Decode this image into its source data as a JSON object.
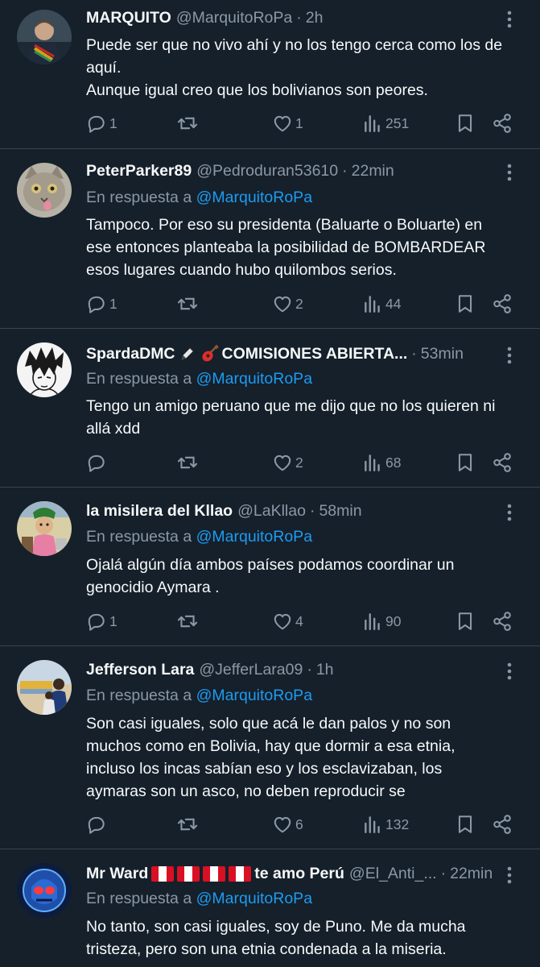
{
  "colors": {
    "background": "#15202b",
    "divider": "#38444d",
    "muted": "#8b98a5",
    "accent": "#1d9bf0",
    "text": "#f7f9f9"
  },
  "reply_prefix": "En respuesta a",
  "tweets": [
    {
      "name": "MARQUITO",
      "handle": "@MarquitoRoPa",
      "time": "2h",
      "reply_to": null,
      "lines": [
        "Puede ser que no vivo ahí y no los tengo cerca como los de",
        "aquí.",
        "Aunque igual creo que los bolivianos son peores."
      ],
      "replies": "1",
      "retweets": "",
      "likes": "1",
      "views": "251"
    },
    {
      "name": "PeterParker89",
      "handle": "@Pedroduran53610",
      "time": "22min",
      "reply_to": "@MarquitoRoPa",
      "lines": [
        "Tampoco. Por eso su presidenta (Baluarte o Boluarte) en",
        "ese entonces planteaba la posibilidad de BOMBARDEAR",
        "esos lugares cuando hubo quilombos serios."
      ],
      "replies": "1",
      "retweets": "",
      "likes": "2",
      "views": "44"
    },
    {
      "name": "SpardaDMC",
      "name_suffix": "COMISIONES ABIERTA...",
      "handle": "",
      "time": "53min",
      "reply_to": "@MarquitoRoPa",
      "lines": [
        "Tengo un amigo peruano que me dijo que no los quieren ni",
        "allá xdd"
      ],
      "replies": "",
      "retweets": "",
      "likes": "2",
      "views": "68"
    },
    {
      "name": "la misilera del Kllao",
      "handle": "@LaKllao",
      "time": "58min",
      "reply_to": "@MarquitoRoPa",
      "lines": [
        "Ojalá algún día ambos países podamos coordinar un",
        "genocidio Aymara ."
      ],
      "replies": "1",
      "retweets": "",
      "likes": "4",
      "views": "90"
    },
    {
      "name": "Jefferson Lara",
      "handle": "@JefferLara09",
      "time": "1h",
      "reply_to": "@MarquitoRoPa",
      "lines": [
        "Son casi iguales, solo que acá le dan palos y no son",
        "muchos como en Bolivia, hay que dormir a esa etnia,",
        "incluso los incas sabían eso y los esclavizaban,  los",
        "aymaras son un asco, no deben reproducir se"
      ],
      "replies": "",
      "retweets": "",
      "likes": "6",
      "views": "132"
    },
    {
      "name": "Mr Ward",
      "name_suffix": "te amo Perú",
      "handle": "@El_Anti_...",
      "time": "22min",
      "reply_to": "@MarquitoRoPa",
      "lines": [
        "No tanto, son casi iguales, soy de Puno. Me da mucha",
        "tristeza, pero son una etnia condenada a la miseria."
      ],
      "replies": "",
      "retweets": "",
      "likes": "",
      "views": ""
    }
  ]
}
